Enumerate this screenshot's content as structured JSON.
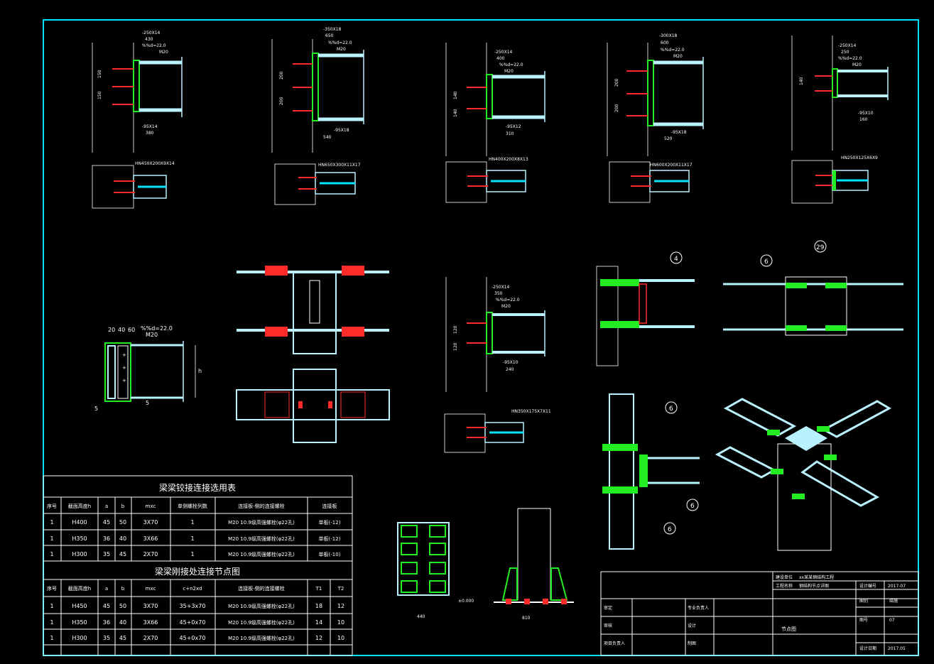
{
  "colors": {
    "background": "#000000",
    "frame": "#00e5ff",
    "beam": "#b9f1ff",
    "line": "#ffffff",
    "weld_green": "#22ee22",
    "bolt_red": "#ff2a2a",
    "bolt_white": "#ffffff"
  },
  "details": {
    "d1": {
      "plate": "-250X14",
      "w": "430",
      "bolt": "%%d=22.0",
      "grade": "M20",
      "stiff": "-95X14",
      "dim_b": "380",
      "dims": [
        "150",
        "150",
        "75"
      ],
      "section": "HN450X200X9X14"
    },
    "d2": {
      "plate": "-350X18",
      "w": "650",
      "bolt": "%%d=22.0",
      "grade": "M20",
      "stiff": "-95X18",
      "dim_b": "540",
      "dims": [
        "200",
        "200",
        "100"
      ],
      "section": "HN650X300X11X17"
    },
    "d3": {
      "plate": "-250X14",
      "w": "400",
      "bolt": "%%d=22.0",
      "grade": "M20",
      "stiff": "-95X12",
      "dim_b": "310",
      "dims": [
        "140",
        "140"
      ],
      "section": "HN400X200X8X13"
    },
    "d4": {
      "plate": "-300X18",
      "w": "600",
      "bolt": "%%d=22.0",
      "grade": "M20",
      "stiff": "-95X18",
      "dim_b": "520",
      "dims": [
        "200",
        "200",
        "100"
      ],
      "section": "HN600X200X11X17"
    },
    "d5": {
      "plate": "-250X14",
      "w": "250",
      "bolt": "%%d=22.0",
      "grade": "M20",
      "stiff": "-95X10",
      "dim_b": "160",
      "dims": [
        "140",
        "55"
      ],
      "section": "HN250X125X6X9"
    },
    "d6": {
      "plate": "-250X14",
      "w": "350",
      "bolt": "%%d=22.0",
      "grade": "M20",
      "stiff": "-95X10",
      "dim_b": "240",
      "dims": [
        "120",
        "120"
      ],
      "section": "HN350X175X7X11"
    }
  },
  "misc": {
    "gusset_dims": [
      "20",
      "40",
      "60"
    ],
    "gusset_bolt": "%%d=22.0",
    "gusset_grade": "M20",
    "tag_a": "5",
    "tag_b": "5",
    "height_h": "h",
    "bubble_4": "4",
    "bubble_6": "6",
    "bubble_29": "29",
    "base_width": "810",
    "base_dim": "440",
    "base_level": "±0.000"
  },
  "table1": {
    "title": "梁梁铰接连接选用表",
    "headers": [
      "序号",
      "截面高度h",
      "a",
      "b",
      "mxc",
      "单侧螺栓列数",
      "连接板-侧的连接螺栓",
      "连接板"
    ],
    "rows": [
      [
        "1",
        "H400",
        "45",
        "50",
        "3X70",
        "1",
        "M20 10.9级高强螺栓(φ22孔)",
        "单板(-12)"
      ],
      [
        "1",
        "H350",
        "36",
        "40",
        "3X66",
        "1",
        "M20 10.9级高强螺栓(φ22孔)",
        "单板(-12)"
      ],
      [
        "1",
        "H300",
        "35",
        "45",
        "2X70",
        "1",
        "M20 10.9级高强螺栓(φ22孔)",
        "单板(-10)"
      ]
    ]
  },
  "table2": {
    "title": "梁梁刚接处连接节点图",
    "headers": [
      "序号",
      "截面高度h",
      "a",
      "b",
      "mxc",
      "c+n2xd",
      "连接板-侧的连接螺栓",
      "T1",
      "T2"
    ],
    "rows": [
      [
        "1",
        "H450",
        "45",
        "50",
        "3X70",
        "35+3x70",
        "M20 10.9级高强螺栓(φ22孔)",
        "18",
        "12"
      ],
      [
        "1",
        "H350",
        "36",
        "40",
        "3X66",
        "45+0x70",
        "M20 10.9级高强螺栓(φ22孔)",
        "14",
        "10"
      ],
      [
        "1",
        "H300",
        "35",
        "45",
        "2X70",
        "45+0x70",
        "M20 10.9级高强螺栓(φ22孔)",
        "12",
        "10"
      ]
    ]
  },
  "titleblock": {
    "project_label": "建设单位",
    "project": "xx某某钢结构工程",
    "sub_label": "工程名称",
    "sub": "钢结构节点详图",
    "no_label": "设计编号",
    "no": "2017-07",
    "r1a": "审定",
    "r1b": "专业负责人",
    "r2a": "审核",
    "r2b": "设计",
    "r3a": "项目负责人",
    "r3b": "制图",
    "sheet_name": "节点图",
    "sheet_label": "图别",
    "sheet_val": "结施",
    "num_label": "图号",
    "num_val": "07",
    "date_label": "设计日期",
    "date_val": "2017.05"
  }
}
